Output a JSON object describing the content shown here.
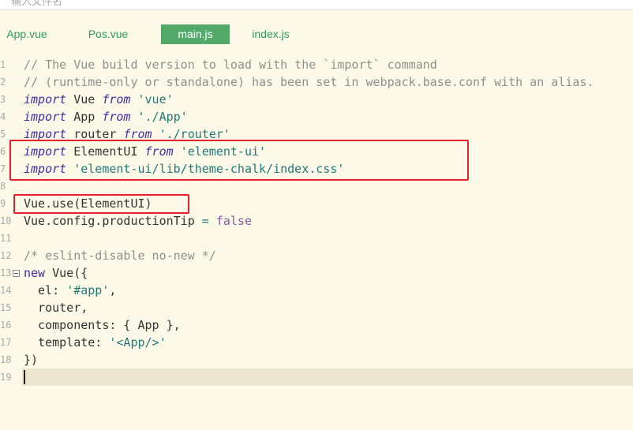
{
  "header": {
    "hint_text": "输入文件名"
  },
  "tabs": [
    {
      "label": "App.vue",
      "active": false
    },
    {
      "label": "Pos.vue",
      "active": false
    },
    {
      "label": "main.js",
      "active": true
    },
    {
      "label": "index.js",
      "active": false
    }
  ],
  "gutter": {
    "numbers": [
      "1",
      "2",
      "3",
      "4",
      "5",
      "6",
      "7",
      "8",
      "9",
      "10",
      "11",
      "12",
      "13",
      "14",
      "15",
      "16",
      "17",
      "18",
      "19"
    ]
  },
  "code": {
    "l1": "// The Vue build version to load with the `import` command",
    "l2": "// (runtime-only or standalone) has been set in webpack.base.conf with an alias.",
    "l3_kw": "import",
    "l3_id": " Vue ",
    "l3_from": "from",
    "l3_str": " 'vue'",
    "l4_kw": "import",
    "l4_id": " App ",
    "l4_from": "from",
    "l4_str": " './App'",
    "l5_kw": "import",
    "l5_id": " router ",
    "l5_from": "from",
    "l5_str": " './router'",
    "l6_kw": "import",
    "l6_id": " ElementUI ",
    "l6_from": "from",
    "l6_str": " 'element-ui'",
    "l7_kw": "import",
    "l7_str": " 'element-ui/lib/theme-chalk/index.css'",
    "l9": "Vue.use(ElementUI)",
    "l10_a": "Vue.config.productionTip ",
    "l10_eq": "=",
    "l10_b": " false",
    "l12": "/* eslint-disable no-new */",
    "l13_kw": "new",
    "l13_rest": " Vue({",
    "l14_key": "  el: ",
    "l14_str": "'#app'",
    "l14_end": ",",
    "l15": "  router,",
    "l16": "  components: { App },",
    "l17_key": "  template: ",
    "l17_str": "'<App/>'",
    "l18": "})"
  },
  "colors": {
    "highlight_box": "#e8202a",
    "active_tab": "#52a96a",
    "tab_text": "#2e9e5b",
    "editor_bg": "#fdf9e8"
  }
}
